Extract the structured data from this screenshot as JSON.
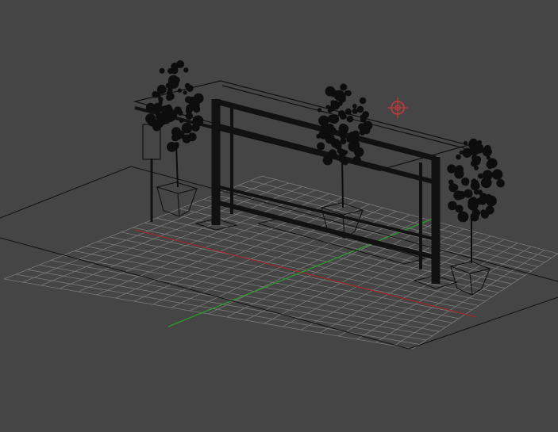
{
  "app": {
    "view": "perspective-viewport",
    "background_color": "#454545",
    "grid_color": "#7a7a7a",
    "axis_x_color": "#9a2a2a",
    "axis_y_color": "#2e9a2e",
    "wire_color": "#0c0c0c",
    "gizmo_color": "#c83a3a"
  },
  "scene": {
    "objects": [
      {
        "name": "bus-stop-shelter",
        "icon": "wireframe-mesh"
      },
      {
        "name": "tree-left",
        "icon": "tree-icon"
      },
      {
        "name": "tree-center",
        "icon": "tree-icon"
      },
      {
        "name": "tree-right",
        "icon": "tree-icon"
      },
      {
        "name": "sign-post",
        "icon": "sign-icon"
      },
      {
        "name": "ground-plane",
        "icon": "plane-icon"
      }
    ],
    "gizmo": {
      "name": "pivot-target",
      "icon": "crosshair-icon"
    }
  }
}
